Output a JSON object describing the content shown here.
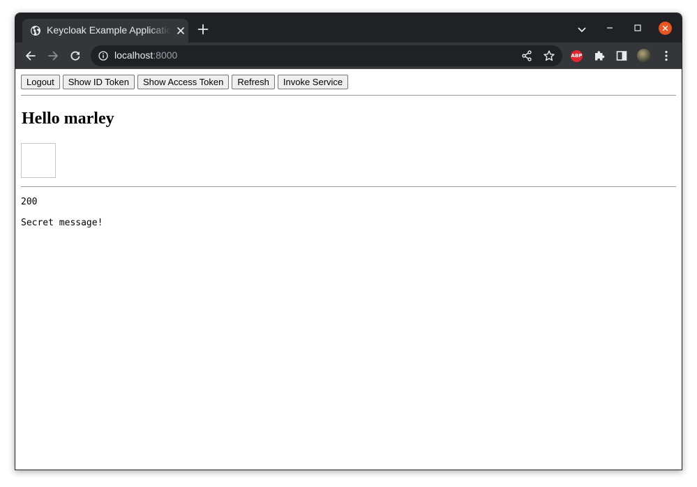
{
  "browser": {
    "tab": {
      "title": "Keycloak Example Application",
      "favicon": "globe-icon"
    },
    "address_bar": {
      "host": "localhost",
      "port": ":8000"
    },
    "extensions": {
      "abp_label": "ABP"
    },
    "window_close_color": "#e95420"
  },
  "page": {
    "buttons": {
      "logout": "Logout",
      "show_id_token": "Show ID Token",
      "show_access_token": "Show Access Token",
      "refresh": "Refresh",
      "invoke_service": "Invoke Service"
    },
    "greeting": "Hello marley",
    "status_code": "200",
    "service_message": "Secret message!"
  }
}
